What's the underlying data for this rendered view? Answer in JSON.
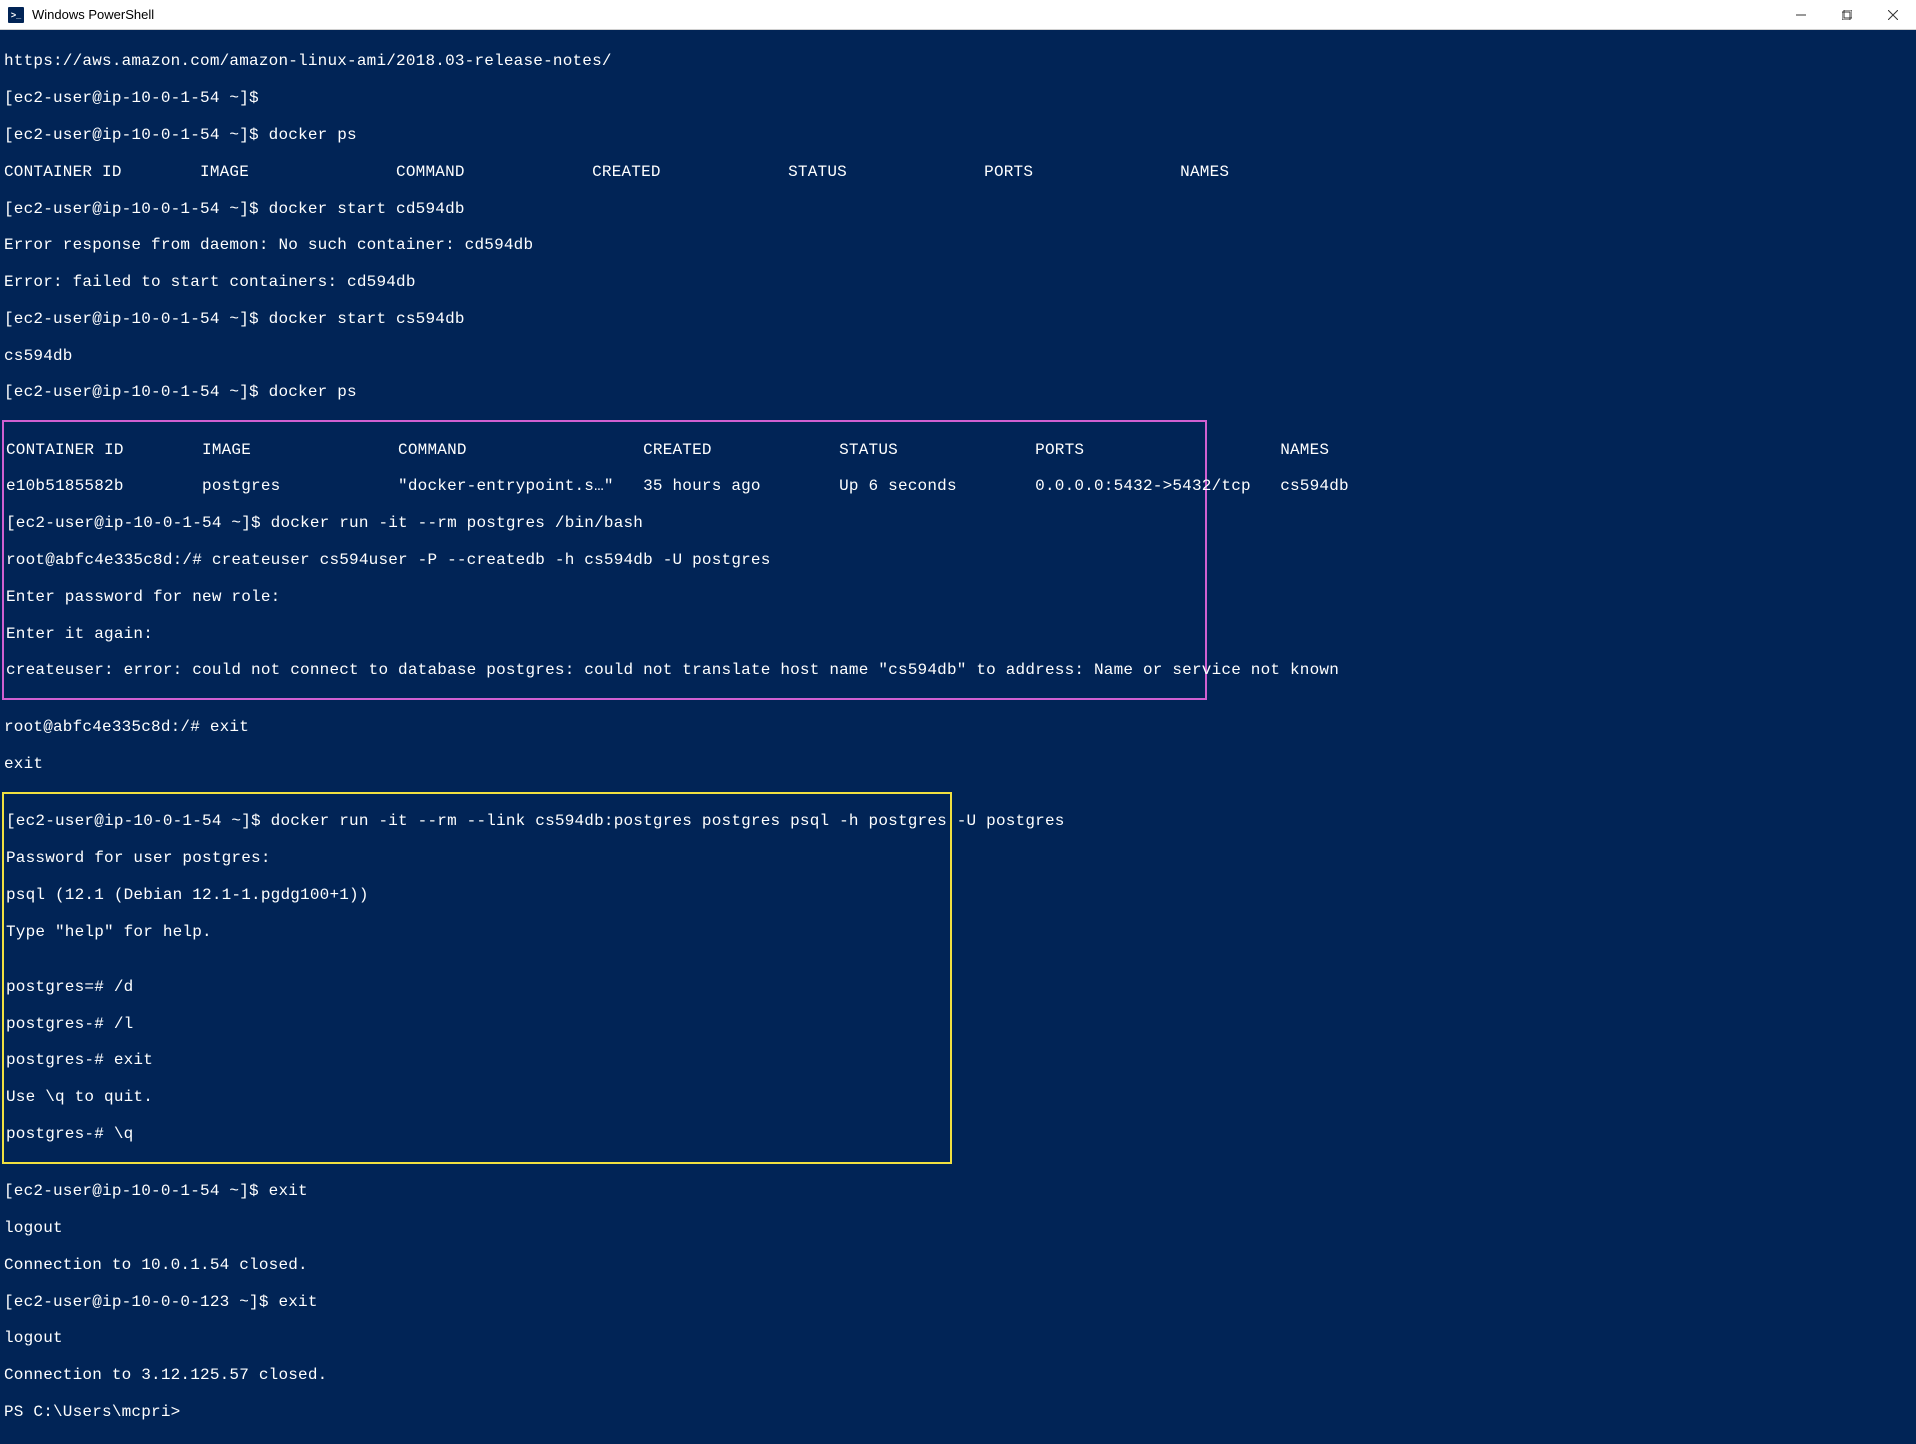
{
  "window": {
    "title": "Windows PowerShell",
    "icon_label": ">_"
  },
  "term": {
    "l01": "https://aws.amazon.com/amazon-linux-ami/2018.03-release-notes/",
    "l02": "[ec2-user@ip-10-0-1-54 ~]$",
    "l03": "[ec2-user@ip-10-0-1-54 ~]$ docker ps",
    "l04": "CONTAINER ID        IMAGE               COMMAND             CREATED             STATUS              PORTS               NAMES",
    "l05": "[ec2-user@ip-10-0-1-54 ~]$ docker start cd594db",
    "l06": "Error response from daemon: No such container: cd594db",
    "l07": "Error: failed to start containers: cd594db",
    "l08": "[ec2-user@ip-10-0-1-54 ~]$ docker start cs594db",
    "l09": "cs594db",
    "l10": "[ec2-user@ip-10-0-1-54 ~]$ docker ps",
    "l11": "CONTAINER ID        IMAGE               COMMAND                  CREATED             STATUS              PORTS                    NAMES",
    "l12": "e10b5185582b        postgres            \"docker-entrypoint.s…\"   35 hours ago        Up 6 seconds        0.0.0.0:5432->5432/tcp   cs594db",
    "l13": "[ec2-user@ip-10-0-1-54 ~]$ docker run -it --rm postgres /bin/bash",
    "l14": "root@abfc4e335c8d:/# createuser cs594user -P --createdb -h cs594db -U postgres",
    "l15": "Enter password for new role:",
    "l16": "Enter it again:",
    "l17": "createuser: error: could not connect to database postgres: could not translate host name \"cs594db\" to address: Name or service not known",
    "l18": "root@abfc4e335c8d:/# exit",
    "l19": "exit",
    "l20": "[ec2-user@ip-10-0-1-54 ~]$ docker run -it --rm --link cs594db:postgres postgres psql -h postgres -U postgres",
    "l21": "Password for user postgres:",
    "l22": "psql (12.1 (Debian 12.1-1.pgdg100+1))",
    "l23": "Type \"help\" for help.",
    "l24": "",
    "l25": "postgres=# /d",
    "l26": "postgres-# /l",
    "l27": "postgres-# exit",
    "l28": "Use \\q to quit.",
    "l29": "postgres-# \\q",
    "l30": "[ec2-user@ip-10-0-1-54 ~]$ exit",
    "l31": "logout",
    "l32": "Connection to 10.0.1.54 closed.",
    "l33": "[ec2-user@ip-10-0-0-123 ~]$ exit",
    "l34": "logout",
    "l35": "Connection to 3.12.125.57 closed.",
    "l36": "PS C:\\Users\\mcpri>"
  }
}
